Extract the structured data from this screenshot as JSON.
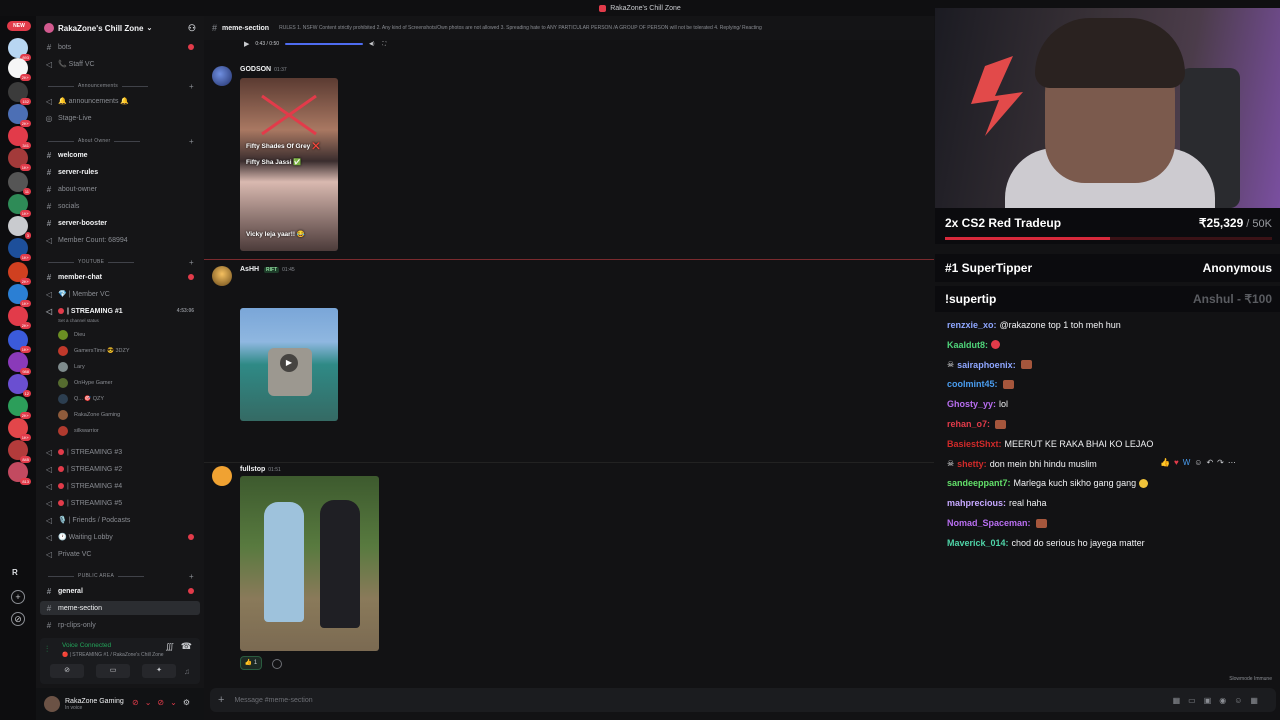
{
  "window": {
    "title": "RakaZone's Chill Zone"
  },
  "rail": {
    "new_badge": "NEW",
    "servers": [
      {
        "color": "#b8d6f2",
        "badge": "893"
      },
      {
        "color": "#f6f6f6",
        "badge": "2K+"
      },
      {
        "color": "#3b3b3b",
        "badge": "152"
      },
      {
        "color": "#4c6fb5",
        "badge": "2K+"
      },
      {
        "color": "#e23b4a",
        "badge": "341"
      },
      {
        "color": "#a33a3a",
        "badge": "1K+"
      },
      {
        "color": "#555",
        "badge": "11"
      },
      {
        "color": "#2e8b57",
        "badge": "1K+"
      },
      {
        "color": "#c9cbcf",
        "badge": "3"
      },
      {
        "color": "#1d4f9a",
        "badge": "1K+"
      },
      {
        "color": "#d04020",
        "badge": "2K+"
      },
      {
        "color": "#2b7fd4",
        "badge": "1K+"
      },
      {
        "color": "#e23b4a",
        "badge": "2K+"
      },
      {
        "color": "#3b5bdb",
        "badge": "1K+"
      },
      {
        "color": "#8a3ab9",
        "badge": "988"
      },
      {
        "color": "#6a4fd1",
        "badge": "12"
      },
      {
        "color": "#2c9e5a",
        "badge": "2K+"
      },
      {
        "color": "#e2464a",
        "badge": "1K+"
      },
      {
        "color": "#b33b3b",
        "badge": "845"
      },
      {
        "color": "#c24a60",
        "badge": "813"
      }
    ],
    "r_label": "R"
  },
  "sidebar": {
    "server_name": "RakaZone's Chill Zone",
    "channels_top": [
      {
        "glyph": "#",
        "name": "bots",
        "bold": false,
        "dot": true
      },
      {
        "glyph": "◁",
        "name": "📞 Staff VC",
        "bold": false
      }
    ],
    "cat_announcements": "Announcements",
    "channels_ann": [
      {
        "glyph": "◁",
        "name": "🔔 announcements 🔔"
      },
      {
        "glyph": "◎",
        "name": "Stage-Live"
      }
    ],
    "cat_about": "About Owner",
    "channels_about": [
      {
        "glyph": "#",
        "name": "welcome",
        "bold": true
      },
      {
        "glyph": "#",
        "name": "server-rules",
        "bold": true
      },
      {
        "glyph": "#",
        "name": "about-owner"
      },
      {
        "glyph": "#",
        "name": "socials"
      },
      {
        "glyph": "#",
        "name": "server-booster",
        "bold": true
      },
      {
        "glyph": "◁",
        "name": "Member Count: 68994"
      }
    ],
    "cat_youtube": "YOUTUBE",
    "member_chat": "member-chat",
    "member_vc": "💎 | Member VC",
    "streaming1": "| STREAMING #1",
    "streaming1_time": "4:53:06",
    "streaming1_status": "Set a channel status",
    "voice_members": [
      {
        "name": "Dieu",
        "color": "#6b8e23"
      },
      {
        "name": "GamersTime 😎 3DZY",
        "color": "#c0392b"
      },
      {
        "name": "Lary",
        "color": "#7f8c8d"
      },
      {
        "name": "OnHype Gamer",
        "color": "#556b2f"
      },
      {
        "name": "Q... 🎯 QZY",
        "color": "#2c3e50"
      },
      {
        "name": "RakaZone Gaming",
        "color": "#8e5b3b"
      },
      {
        "name": "silkwarrior",
        "color": "#b03a2e"
      }
    ],
    "channels_stream": [
      {
        "name": "| STREAMING #3"
      },
      {
        "name": "| STREAMING #2"
      },
      {
        "name": "| STREAMING #4"
      },
      {
        "name": "| STREAMING #5"
      },
      {
        "name": "🎙️ | Friends / Podcasts"
      },
      {
        "name": "🕐 Waiting Lobby",
        "dot": true
      },
      {
        "name": "Private VC"
      }
    ],
    "cat_public": "PUBLIC AREA",
    "general": "general",
    "meme_section": "meme-section",
    "rp_clips": "rp-clips-only",
    "voice_connected": "Voice Connected",
    "voice_sub": "🔴 | STREAMING #1 / RakaZone's Chill Zone",
    "user_name": "RakaZone Gaming",
    "user_status": "In voice"
  },
  "channel_header": {
    "name": "meme-section",
    "rules": "RULES 1. NSFW Content strictly prohibited 2. Any kind of Screenshots/Own photos are not allowed 3. Spreading hate to ANY PARTICULAR PERSON /A GROUP OF PERSON will not be tolerated 4. Replying/ Reacting"
  },
  "player": {
    "time": "0:43 / 0:50"
  },
  "messages": [
    {
      "author": "GODSON",
      "time": "01:37",
      "caption1": "Fifty Shades Of Grey ❌",
      "caption2": "Fifty Sha      Jassi ✅",
      "caption3": "Vicky leja yaar!! 😂",
      "author_color": "#f2f3f5"
    },
    {
      "author": "AsHH",
      "tag": "RIFT",
      "time": "01:45",
      "author_color": "#f2f3f5"
    },
    {
      "author": "fullstop",
      "time": "01:51",
      "author_color": "#f2f3f5"
    }
  ],
  "reaction": {
    "count": "1"
  },
  "composer": {
    "placeholder": "Message #meme-section"
  },
  "slowmode": "Slowmode Immune",
  "overlay": {
    "goal_title": "2x CS2 Red Tradeup",
    "goal_amount": "₹25,329",
    "goal_target": " / 50K",
    "goal_progress": 0.506,
    "supertipper_label": "#1 SuperTipper",
    "supertipper_name": "Anonymous",
    "supertip_label": "!supertip",
    "supertip_name": "Anshul - ₹100"
  },
  "chat": [
    {
      "user": "renzxie_xo:",
      "color": "#8ea6ff",
      "text": "@rakazone top 1 toh meh hun"
    },
    {
      "user": "Kaaldut8:",
      "color": "#4fd47a",
      "text": "",
      "emote": "red"
    },
    {
      "user": "sairaphoenix:",
      "color": "#8ea6ff",
      "text": "",
      "emote": "em",
      "skull": true
    },
    {
      "user": "coolmint45:",
      "color": "#4a9df0",
      "text": "",
      "emote": "em"
    },
    {
      "user": "Ghosty_yy:",
      "color": "#b86ef0",
      "text": "lol"
    },
    {
      "user": "rehan_o7:",
      "color": "#e23b4a",
      "text": "",
      "emote": "em"
    },
    {
      "user": "BasiestShxt:",
      "color": "#d02a2a",
      "text": "MEERUT KE RAKA BHAI KO LEJAO"
    },
    {
      "user": "shetty:",
      "color": "#d02a2a",
      "text": "don mein bhi hindu muslim",
      "skull": true
    },
    {
      "user": "sandeeppant7:",
      "color": "#63e06a",
      "text": "Marlega kuch sikho gang gang",
      "emote": "ye"
    },
    {
      "user": "mahprecious:",
      "color": "#c6a8ff",
      "text": "real haha"
    },
    {
      "user": "Nomad_Spaceman:",
      "color": "#b86ef0",
      "text": "",
      "emote": "em"
    },
    {
      "user": "Maverick_014:",
      "color": "#4fd4a8",
      "text": "chod do serious ho jayega matter"
    }
  ]
}
